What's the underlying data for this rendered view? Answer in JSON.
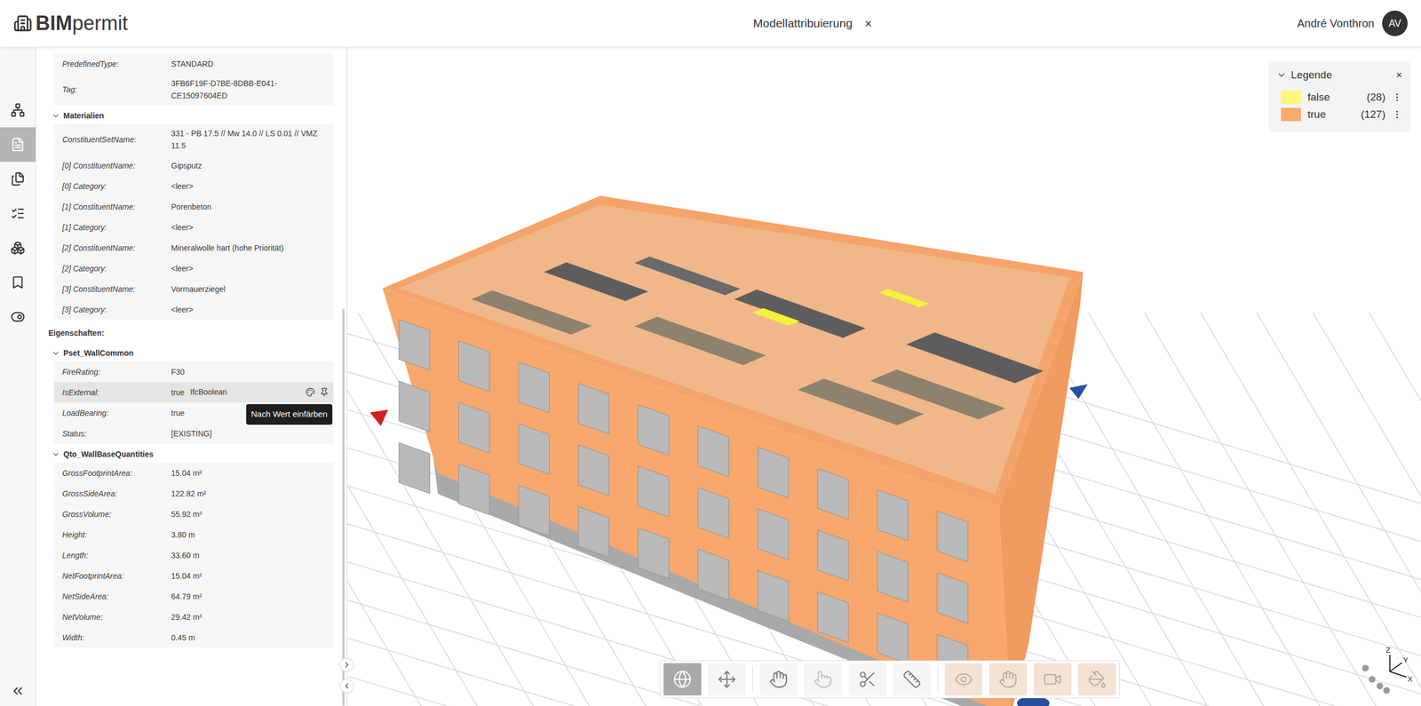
{
  "header": {
    "logo_bold": "BIM",
    "logo_light": "permit",
    "title": "Modellattribuierung",
    "close": "×",
    "user": "André Vonthron",
    "avatar": "AV"
  },
  "rail": {
    "items": [
      {
        "selected": false
      },
      {
        "selected": true
      },
      {
        "selected": false
      },
      {
        "selected": false
      },
      {
        "selected": false
      },
      {
        "selected": false
      },
      {
        "selected": false
      }
    ]
  },
  "panel": {
    "sections": [
      {
        "kind": "card",
        "rows": [
          {
            "label": "PredefinedType:",
            "value": "STANDARD",
            "highlighted": false
          },
          {
            "label": "Tag:",
            "value": "3FB6F19F-D7BE-8DBB-E041-CE15097604ED",
            "highlighted": false
          }
        ]
      },
      {
        "kind": "group",
        "title": "Materialien",
        "expanded": true,
        "rows": [
          {
            "label": "ConstituentSetName:",
            "value": "331 - PB 17.5 // Mw 14.0 // LS 0.01 // VMZ 11.5",
            "highlighted": false
          },
          {
            "label": "[0] ConstituentName:",
            "value": "Gipsputz",
            "highlighted": false
          },
          {
            "label": "[0] Category:",
            "value": "<leer>",
            "highlighted": false
          },
          {
            "label": "[1] ConstituentName:",
            "value": "Porenbeton",
            "highlighted": false
          },
          {
            "label": "[1] Category:",
            "value": "<leer>",
            "highlighted": false
          },
          {
            "label": "[2] ConstituentName:",
            "value": "Mineralwolle hart (hohe Priorität)",
            "highlighted": false
          },
          {
            "label": "[2] Category:",
            "value": "<leer>",
            "highlighted": false
          },
          {
            "label": "[3] ConstituentName:",
            "value": "Vormauerziegel",
            "highlighted": false
          },
          {
            "label": "[3] Category:",
            "value": "<leer>",
            "highlighted": false
          }
        ]
      },
      {
        "kind": "heading",
        "title": "Eigenschaften:"
      },
      {
        "kind": "group",
        "title": "Pset_WallCommon",
        "expanded": true,
        "rows": [
          {
            "label": "FireRating:",
            "value": "F30",
            "highlighted": false
          },
          {
            "label": "IsExternal:",
            "value": "true",
            "type": "IfcBoolean",
            "highlighted": true,
            "tooltip": "Nach Wert einfärben"
          },
          {
            "label": "LoadBearing:",
            "value": "true",
            "highlighted": false
          },
          {
            "label": "Status:",
            "value": "[EXISTING]",
            "highlighted": false
          }
        ]
      },
      {
        "kind": "group",
        "title": "Qto_WallBaseQuantities",
        "expanded": true,
        "rows": [
          {
            "label": "GrossFootprintArea:",
            "value": "15.04 m²",
            "highlighted": false
          },
          {
            "label": "GrossSideArea:",
            "value": "122.82 m²",
            "highlighted": false
          },
          {
            "label": "GrossVolume:",
            "value": "55.92 m³",
            "highlighted": false
          },
          {
            "label": "Height:",
            "value": "3.80 m",
            "highlighted": false
          },
          {
            "label": "Length:",
            "value": "33.60 m",
            "highlighted": false
          },
          {
            "label": "NetFootprintArea:",
            "value": "15.04 m²",
            "highlighted": false
          },
          {
            "label": "NetSideArea:",
            "value": "64.79 m²",
            "highlighted": false
          },
          {
            "label": "NetVolume:",
            "value": "29.42 m³",
            "highlighted": false
          },
          {
            "label": "Width:",
            "value": "0.45 m",
            "highlighted": false
          }
        ]
      }
    ]
  },
  "legend": {
    "title": "Legende",
    "close": "×",
    "expanded": true,
    "items": [
      {
        "label": "false",
        "count": "(28)",
        "color": "#fbf77a"
      },
      {
        "label": "true",
        "count": "(127)",
        "color": "#f9ab6e"
      }
    ]
  },
  "toolbar": {
    "buttons": [
      {
        "selected": true,
        "disabled": false,
        "tinted": false
      },
      {
        "selected": false,
        "disabled": false,
        "tinted": false
      },
      {
        "selected": false,
        "disabled": false,
        "tinted": false
      },
      {
        "selected": false,
        "disabled": true,
        "tinted": false
      },
      {
        "selected": false,
        "disabled": false,
        "tinted": false
      },
      {
        "selected": false,
        "disabled": false,
        "tinted": false
      },
      {
        "selected": false,
        "disabled": false,
        "tinted": true
      },
      {
        "selected": false,
        "disabled": false,
        "tinted": true
      },
      {
        "selected": false,
        "disabled": false,
        "tinted": true
      },
      {
        "selected": false,
        "disabled": false,
        "tinted": true
      }
    ]
  },
  "axes": {
    "labels": [
      "Z",
      "Y",
      "X"
    ]
  }
}
